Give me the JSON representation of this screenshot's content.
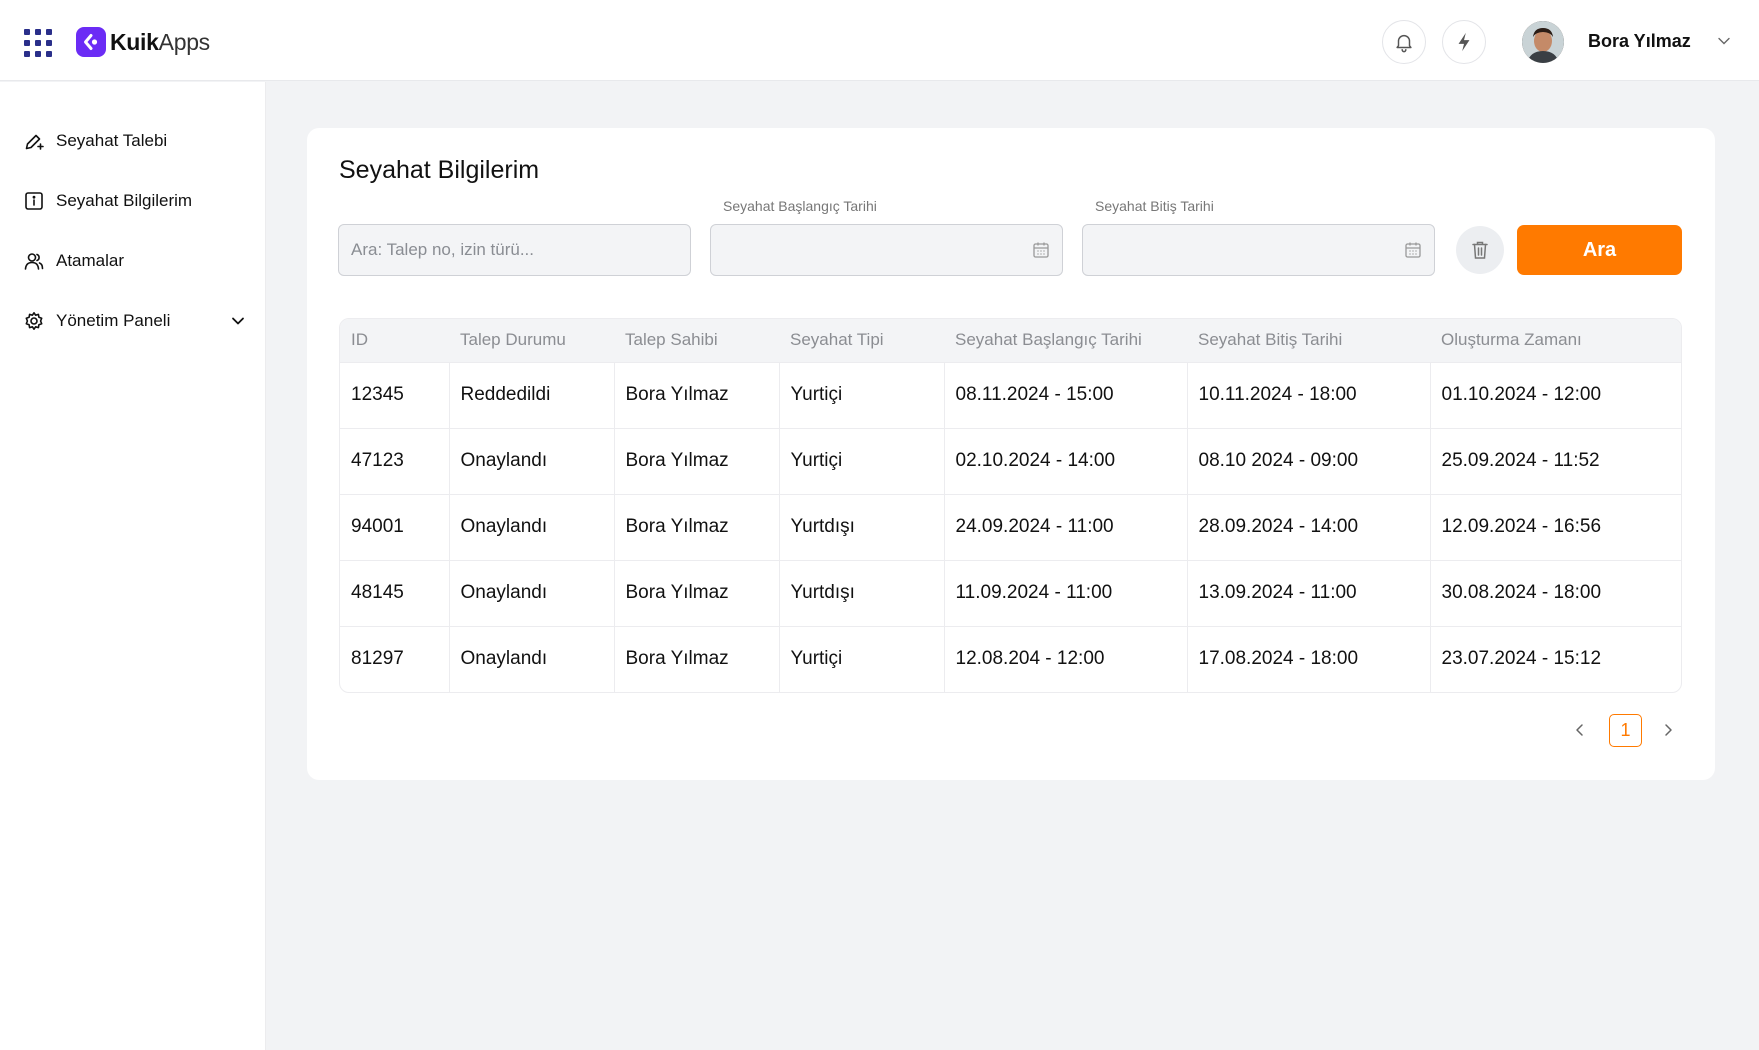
{
  "header": {
    "logo_bold": "Kuik",
    "logo_light": "Apps",
    "user_name": "Bora Yılmaz",
    "icons": [
      "apps-grid-icon",
      "bell-icon",
      "bolt-icon",
      "chevron-down-icon"
    ]
  },
  "sidebar": {
    "items": [
      {
        "label": "Seyahat Talebi",
        "icon": "edit-plus-icon"
      },
      {
        "label": "Seyahat Bilgilerim",
        "icon": "info-square-icon"
      },
      {
        "label": "Atamalar",
        "icon": "users-icon"
      },
      {
        "label": "Yönetim Paneli",
        "icon": "gear-icon"
      }
    ]
  },
  "main": {
    "title": "Seyahat Bilgilerim",
    "search_placeholder": "Ara: Talep no, izin türü...",
    "start_date_label": "Seyahat Başlangıç Tarihi",
    "end_date_label": "Seyahat Bitiş Tarihi",
    "search_button": "Ara",
    "accent_color": "#ff7a00",
    "table": {
      "columns": [
        "ID",
        "Talep Durumu",
        "Talep Sahibi",
        "Seyahat Tipi",
        "Seyahat Başlangıç Tarihi",
        "Seyahat Bitiş Tarihi",
        "Oluşturma Zamanı"
      ],
      "rows": [
        [
          "12345",
          "Reddedildi",
          "Bora Yılmaz",
          "Yurtiçi",
          "08.11.2024 - 15:00",
          "10.11.2024 - 18:00",
          "01.10.2024 - 12:00"
        ],
        [
          "47123",
          "Onaylandı",
          "Bora Yılmaz",
          "Yurtiçi",
          "02.10.2024 - 14:00",
          "08.10 2024 - 09:00",
          "25.09.2024 - 11:52"
        ],
        [
          "94001",
          "Onaylandı",
          "Bora Yılmaz",
          "Yurtdışı",
          "24.09.2024 - 11:00",
          "28.09.2024 - 14:00",
          "12.09.2024 - 16:56"
        ],
        [
          "48145",
          "Onaylandı",
          "Bora Yılmaz",
          "Yurtdışı",
          "11.09.2024 - 11:00",
          "13.09.2024 - 11:00",
          "30.08.2024 - 18:00"
        ],
        [
          "81297",
          "Onaylandı",
          "Bora Yılmaz",
          "Yurtiçi",
          "12.08.204 - 12:00",
          "17.08.2024 - 18:00",
          "23.07.2024 - 15:12"
        ]
      ]
    },
    "pagination": {
      "current_page": "1"
    }
  }
}
